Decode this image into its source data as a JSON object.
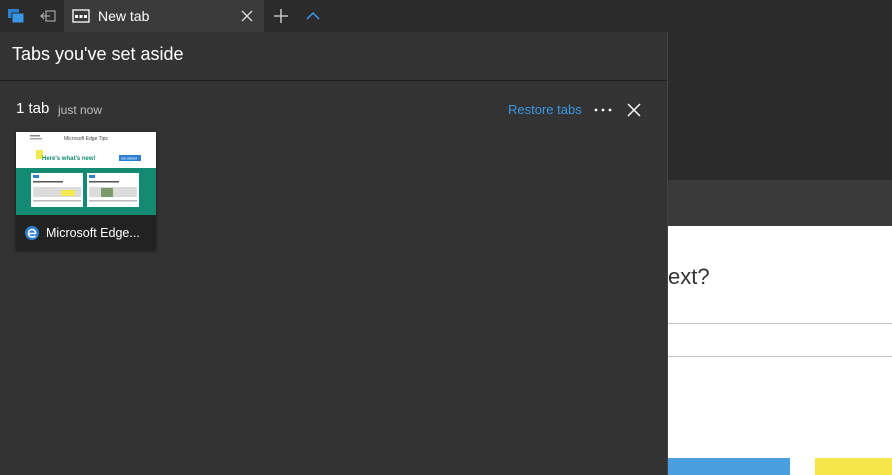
{
  "tabstrip": {
    "tabs": [
      {
        "title": "New tab",
        "active": true
      }
    ]
  },
  "panel": {
    "title": "Tabs you've set aside",
    "group": {
      "count_label": "1 tab",
      "time_label": "just now",
      "restore_label": "Restore tabs"
    },
    "cards": [
      {
        "title": "Microsoft Edge...",
        "preview": {
          "header_text": "Microsoft Edge Tips",
          "heading": "Here's what's new!",
          "button": "Get started"
        }
      }
    ]
  },
  "background_page": {
    "partial_text": "ext?"
  },
  "colors": {
    "accent": "#3a97e6",
    "panel_bg": "#333333",
    "tabstrip_bg": "#2b2b2b",
    "thumb_teal": "#138a72",
    "thumb_yellow": "#f2e94e"
  }
}
